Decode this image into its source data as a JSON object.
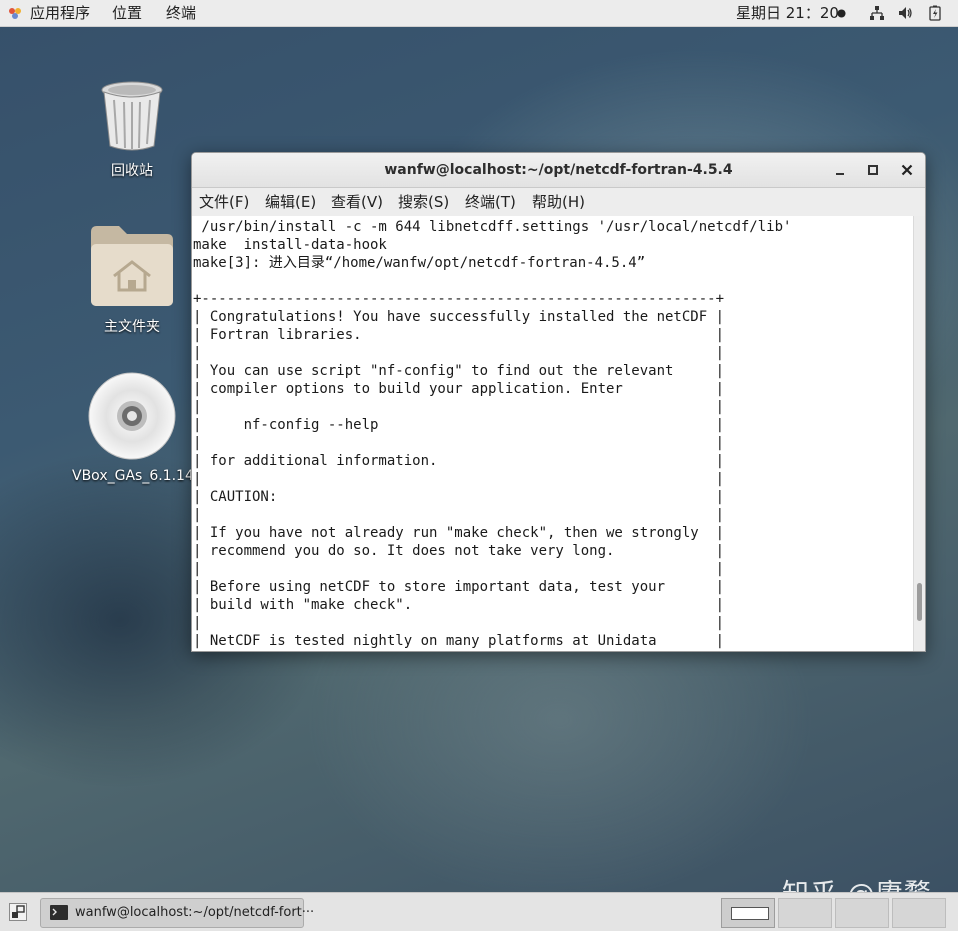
{
  "top_panel": {
    "apps_label": "应用程序",
    "places_label": "位置",
    "terminal_label": "终端",
    "clock": "星期日 21：20",
    "icons": [
      "apps-menu-icon",
      "network-icon",
      "volume-icon",
      "battery-icon"
    ]
  },
  "desktop": {
    "trash_label": "回收站",
    "home_label": "主文件夹",
    "disc_label": "VBox_GAs_6.1.14"
  },
  "terminal": {
    "title": "wanfw@localhost:~/opt/netcdf-fortran-4.5.4",
    "menu": [
      "文件(F)",
      "编辑(E)",
      "查看(V)",
      "搜索(S)",
      "终端(T)",
      "帮助(H)"
    ],
    "lines": [
      " /usr/bin/install -c -m 644 libnetcdff.settings '/usr/local/netcdf/lib'",
      "make  install-data-hook",
      "make[3]: 进入目录“/home/wanfw/opt/netcdf-fortran-4.5.4”",
      "",
      "+-------------------------------------------------------------+",
      "| Congratulations! You have successfully installed the netCDF |",
      "| Fortran libraries.                                          |",
      "|                                                             |",
      "| You can use script \"nf-config\" to find out the relevant     |",
      "| compiler options to build your application. Enter           |",
      "|                                                             |",
      "|     nf-config --help                                        |",
      "|                                                             |",
      "| for additional information.                                 |",
      "|                                                             |",
      "| CAUTION:                                                    |",
      "|                                                             |",
      "| If you have not already run \"make check\", then we strongly  |",
      "| recommend you do so. It does not take very long.            |",
      "|                                                             |",
      "| Before using netCDF to store important data, test your      |",
      "| build with \"make check\".                                    |",
      "|                                                             |",
      "| NetCDF is tested nightly on many platforms at Unidata       |"
    ],
    "scroll_position": 0.93
  },
  "taskbar": {
    "task_label": "wanfw@localhost:~/opt/netcdf-fort···"
  },
  "watermark": "知乎 @赓鹜"
}
